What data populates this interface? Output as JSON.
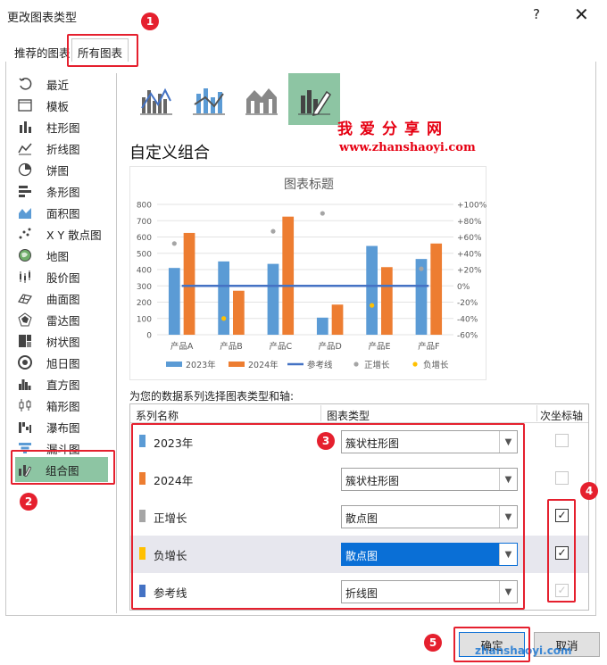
{
  "dialog": {
    "title": "更改图表类型",
    "help": "?",
    "close": "✕"
  },
  "tabs": {
    "recommended": "推荐的图表",
    "all": "所有图表"
  },
  "sidebar": {
    "items": [
      {
        "label": "最近",
        "icon": "recent-icon"
      },
      {
        "label": "模板",
        "icon": "template-icon"
      },
      {
        "label": "柱形图",
        "icon": "column-chart-icon"
      },
      {
        "label": "折线图",
        "icon": "line-chart-icon"
      },
      {
        "label": "饼图",
        "icon": "pie-chart-icon"
      },
      {
        "label": "条形图",
        "icon": "bar-chart-icon"
      },
      {
        "label": "面积图",
        "icon": "area-chart-icon"
      },
      {
        "label": "X Y 散点图",
        "icon": "scatter-chart-icon"
      },
      {
        "label": "地图",
        "icon": "map-chart-icon"
      },
      {
        "label": "股价图",
        "icon": "stock-chart-icon"
      },
      {
        "label": "曲面图",
        "icon": "surface-chart-icon"
      },
      {
        "label": "雷达图",
        "icon": "radar-chart-icon"
      },
      {
        "label": "树状图",
        "icon": "treemap-chart-icon"
      },
      {
        "label": "旭日图",
        "icon": "sunburst-chart-icon"
      },
      {
        "label": "直方图",
        "icon": "histogram-chart-icon"
      },
      {
        "label": "箱形图",
        "icon": "boxplot-chart-icon"
      },
      {
        "label": "瀑布图",
        "icon": "waterfall-chart-icon"
      },
      {
        "label": "漏斗图",
        "icon": "funnel-chart-icon"
      },
      {
        "label": "组合图",
        "icon": "combo-chart-icon"
      }
    ],
    "selected": "组合图"
  },
  "combo": {
    "title": "自定义组合",
    "section_label": "为您的数据系列选择图表类型和轴:",
    "headers": {
      "series": "系列名称",
      "type": "图表类型",
      "secondary": "次坐标轴"
    },
    "rows": [
      {
        "name": "2023年",
        "color": "#5b9bd5",
        "type": "簇状柱形图",
        "secondary": false,
        "enabled": false,
        "active": false
      },
      {
        "name": "2024年",
        "color": "#ed7d31",
        "type": "簇状柱形图",
        "secondary": false,
        "enabled": false,
        "active": false
      },
      {
        "name": "正增长",
        "color": "#a5a5a5",
        "type": "散点图",
        "secondary": true,
        "enabled": true,
        "active": false
      },
      {
        "name": "负增长",
        "color": "#ffc000",
        "type": "散点图",
        "secondary": true,
        "enabled": true,
        "active": true
      },
      {
        "name": "参考线",
        "color": "#4472c4",
        "type": "折线图",
        "secondary": true,
        "enabled": false,
        "active": false
      }
    ]
  },
  "watermark": {
    "line1": "我爱分享网",
    "line2": "www.zhanshaoyi.com",
    "line3": "zhanshaoyi.com"
  },
  "buttons": {
    "ok": "确定",
    "cancel": "取消"
  },
  "callouts": [
    "1",
    "2",
    "3",
    "4",
    "5"
  ],
  "chart_data": {
    "type": "bar",
    "title": "图表标题",
    "categories": [
      "产品A",
      "产品B",
      "产品C",
      "产品D",
      "产品E",
      "产品F"
    ],
    "series": [
      {
        "name": "2023年",
        "color": "#5b9bd5",
        "values": [
          410,
          450,
          435,
          105,
          545,
          465
        ]
      },
      {
        "name": "2024年",
        "color": "#ed7d31",
        "values": [
          625,
          270,
          725,
          185,
          415,
          560
        ]
      },
      {
        "name": "参考线",
        "color": "#4472c4",
        "kind": "line",
        "values": [
          0,
          0,
          0,
          0,
          0,
          0
        ]
      },
      {
        "name": "正增长",
        "color": "#a5a5a5",
        "kind": "scatter",
        "values": [
          52,
          null,
          67,
          89,
          null,
          21
        ]
      },
      {
        "name": "负增长",
        "color": "#ffc000",
        "kind": "scatter",
        "values": [
          null,
          -40,
          null,
          null,
          -24,
          null
        ]
      }
    ],
    "y_ticks": [
      "0",
      "100",
      "200",
      "300",
      "400",
      "500",
      "600",
      "700",
      "800"
    ],
    "y2_ticks": [
      "-60%",
      "-40%",
      "-20%",
      "0%",
      "+20%",
      "+40%",
      "+60%",
      "+80%",
      "+100%"
    ],
    "ylim": [
      0,
      800
    ],
    "y2lim": [
      -60,
      100
    ],
    "legend": "bottom",
    "grid": true
  }
}
